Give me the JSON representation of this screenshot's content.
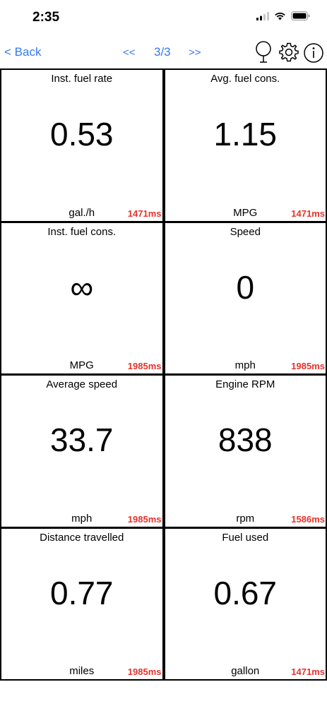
{
  "status_bar": {
    "time": "2:35",
    "icons": [
      "cellular-signal-icon",
      "wifi-icon",
      "battery-icon"
    ]
  },
  "nav": {
    "back_label": "< Back",
    "prev_label": "<<",
    "page_indicator": "3/3",
    "next_label": ">>",
    "icons": [
      "microphone-icon",
      "gear-icon",
      "info-icon"
    ],
    "accent_color": "#3478f6"
  },
  "tiles": [
    {
      "title": "Inst. fuel rate",
      "value": "0.53",
      "unit": "gal./h",
      "timing": "1471ms"
    },
    {
      "title": "Avg. fuel cons.",
      "value": "1.15",
      "unit": "MPG",
      "timing": "1471ms"
    },
    {
      "title": "Inst. fuel cons.",
      "value": "∞",
      "unit": "MPG",
      "timing": "1985ms"
    },
    {
      "title": "Speed",
      "value": "0",
      "unit": "mph",
      "timing": "1985ms"
    },
    {
      "title": "Average speed",
      "value": "33.7",
      "unit": "mph",
      "timing": "1985ms"
    },
    {
      "title": "Engine RPM",
      "value": "838",
      "unit": "rpm",
      "timing": "1586ms"
    },
    {
      "title": "Distance travelled",
      "value": "0.77",
      "unit": "miles",
      "timing": "1985ms"
    },
    {
      "title": "Fuel used",
      "value": "0.67",
      "unit": "gallon",
      "timing": "1471ms"
    }
  ],
  "timing_color": "#e8322c"
}
